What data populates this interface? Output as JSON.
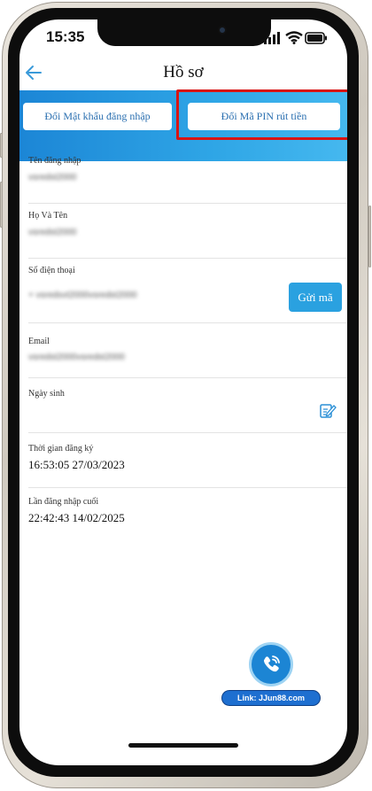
{
  "status_bar": {
    "time": "15:35"
  },
  "header": {
    "title": "Hồ sơ"
  },
  "tabs": [
    {
      "label": "Đổi Mật khẩu đăng nhập"
    },
    {
      "label": "Đổi Mã PIN rút tiền"
    }
  ],
  "fields": [
    {
      "label": "Tên đăng nhập",
      "value": "vsredst2000"
    },
    {
      "label": "Họ Và Tên",
      "value": "vsredst2000"
    },
    {
      "label": "Số điện thoại",
      "value": "+ vsredsvt2000vsredst2000",
      "action_label": "Gửi mã"
    },
    {
      "label": "Email",
      "value": "vsredst2000vsredst2000"
    },
    {
      "label": "Ngày sinh",
      "value": ""
    },
    {
      "label": "Thời gian đăng ký",
      "value": "16:53:05 27/03/2023"
    },
    {
      "label": "Lần đăng nhập cuối",
      "value": "22:42:43 14/02/2025"
    }
  ],
  "support": {
    "link_text": "Link: JJun88.com"
  },
  "colors": {
    "accent": "#2aa1e0",
    "highlight": "#d81414",
    "band_start": "#1c86d6",
    "band_end": "#45b8ef"
  },
  "icons": [
    "back-arrow-icon",
    "signal-icon",
    "wifi-icon",
    "battery-icon",
    "edit-icon",
    "phone-call-icon"
  ]
}
